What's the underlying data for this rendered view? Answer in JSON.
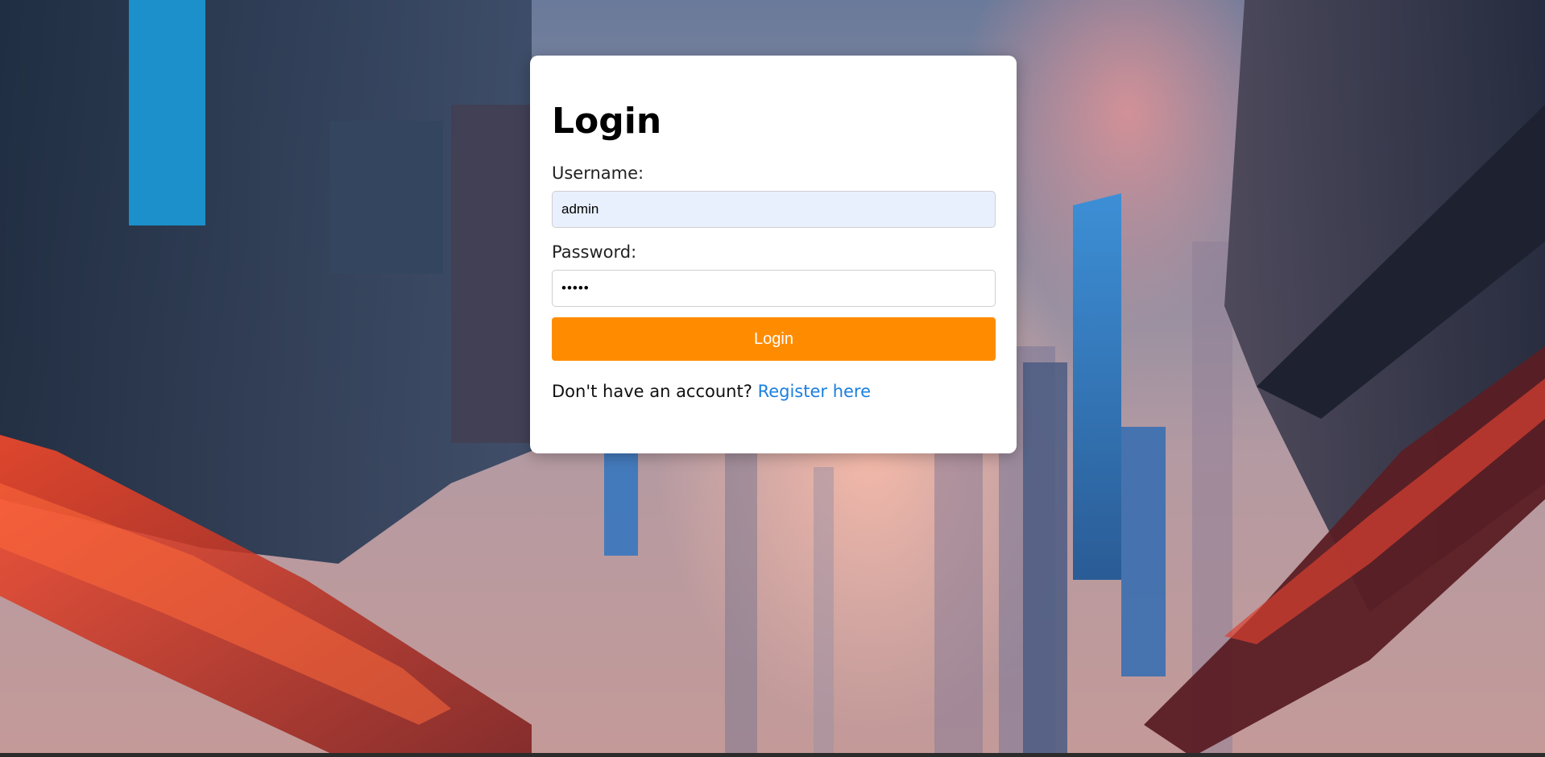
{
  "form": {
    "title": "Login",
    "username_label": "Username:",
    "username_value": "admin",
    "password_label": "Password:",
    "password_value": "admin",
    "submit_label": "Login",
    "register_prompt": "Don't have an account?",
    "register_link": "Register here"
  },
  "colors": {
    "accent_button": "#ff8c00",
    "link": "#1a7fe0",
    "autofill_background": "#e8f0fe"
  }
}
